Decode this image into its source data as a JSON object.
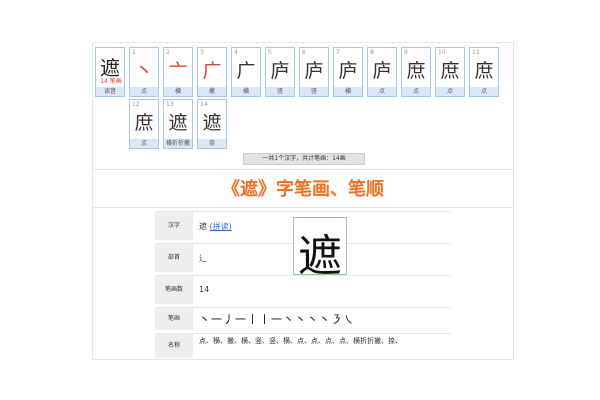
{
  "character": "遮",
  "first_tile": {
    "glyph": "遮",
    "strokes_label": "14 笔画",
    "caption": "读音"
  },
  "tiles": [
    {
      "num": "1",
      "glyph": "丶",
      "caption": "点"
    },
    {
      "num": "2",
      "glyph": "亠",
      "caption": "横"
    },
    {
      "num": "3",
      "glyph": "广",
      "caption": "撇"
    },
    {
      "num": "4",
      "glyph": "广",
      "caption": "横"
    },
    {
      "num": "5",
      "glyph": "庐",
      "caption": "竖"
    },
    {
      "num": "6",
      "glyph": "庐",
      "caption": "竖"
    },
    {
      "num": "7",
      "glyph": "庐",
      "caption": "横"
    },
    {
      "num": "8",
      "glyph": "庐",
      "caption": "点"
    },
    {
      "num": "9",
      "glyph": "庶",
      "caption": "点"
    },
    {
      "num": "10",
      "glyph": "庶",
      "caption": "点"
    },
    {
      "num": "11",
      "glyph": "庶",
      "caption": "点"
    },
    {
      "num": "12",
      "glyph": "庶",
      "caption": "点"
    },
    {
      "num": "13",
      "glyph": "遮",
      "caption": "横折折撇"
    },
    {
      "num": "14",
      "glyph": "遮",
      "caption": "捺"
    }
  ],
  "summary": "一共1个汉字，共计笔画：14画",
  "title": "《遮》字笔画、笔顺",
  "info": {
    "hanzi_label": "汉字",
    "hanzi_value": "遮",
    "hanzi_link": "(拼读)",
    "radical_label": "部首",
    "radical_value": "辶",
    "count_label": "笔画数",
    "count_value": "14",
    "strokes_label": "笔画",
    "strokes_value": "丶一丿一丨丨一丶丶丶丶㇋㇏",
    "names_label": "名称",
    "names_value": "点、横、撇、横、竖、竖、横、点、点、点、点、横折折撇、捺、"
  }
}
